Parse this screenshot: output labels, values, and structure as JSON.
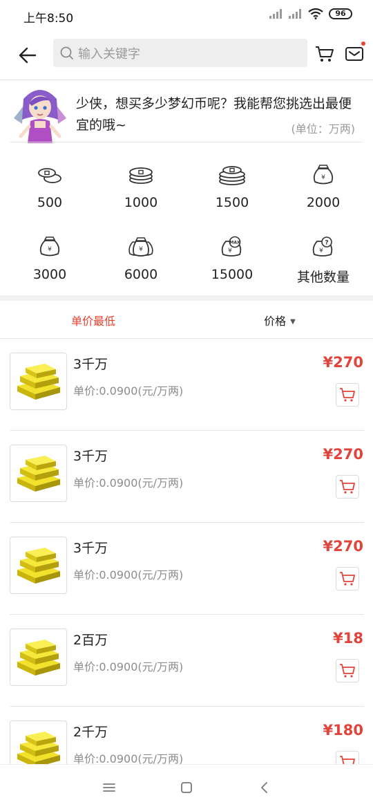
{
  "status_bar": {
    "time": "上午8:50",
    "battery": "96"
  },
  "top_bar": {
    "search_placeholder": "输入关键字"
  },
  "hint": {
    "text": "少侠，想买多少梦幻币呢？我能帮您挑选出最便宜的哦~",
    "unit": "(单位：万两)"
  },
  "amounts": [
    {
      "label": "500",
      "icon": "coins-small-icon"
    },
    {
      "label": "1000",
      "icon": "coins-stack-icon"
    },
    {
      "label": "1500",
      "icon": "coins-pile-icon"
    },
    {
      "label": "2000",
      "icon": "money-bag-icon"
    },
    {
      "label": "3000",
      "icon": "money-bag-icon"
    },
    {
      "label": "6000",
      "icon": "money-bags-icon"
    },
    {
      "label": "15000",
      "icon": "money-bag-max-icon"
    },
    {
      "label": "其他数量",
      "icon": "money-bag-question-icon"
    }
  ],
  "sort": {
    "lowest_label": "单价最低",
    "price_label": "价格"
  },
  "products": [
    {
      "name": "3千万",
      "unit_price": "单价:0.0900(元/万两)",
      "price": "¥270"
    },
    {
      "name": "3千万",
      "unit_price": "单价:0.0900(元/万两)",
      "price": "¥270"
    },
    {
      "name": "3千万",
      "unit_price": "单价:0.0900(元/万两)",
      "price": "¥270"
    },
    {
      "name": "2百万",
      "unit_price": "单价:0.0900(元/万两)",
      "price": "¥18"
    },
    {
      "name": "2千万",
      "unit_price": "单价:0.0900(元/万两)",
      "price": "¥180"
    }
  ],
  "colors": {
    "accent": "#e8412f",
    "price": "#e0443b",
    "gold": "#e8d21a"
  }
}
